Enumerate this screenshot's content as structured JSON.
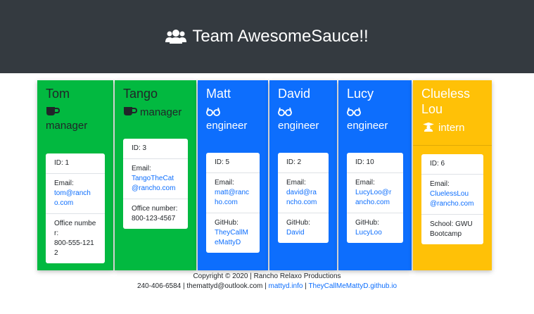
{
  "header": {
    "title": "Team AwesomeSauce!!",
    "icon": "users-icon"
  },
  "colors": {
    "manager": "#02b940",
    "engineer": "#0d6efd",
    "intern": "#ffc107",
    "hero": "#343a40"
  },
  "cards": [
    {
      "name": "Tom",
      "role": "manager",
      "role_icon": "coffee-icon",
      "id_text": "ID: 1",
      "contact_label": "Email:",
      "contact_value": "tom@rancho.com",
      "extra_label": "Office number:",
      "extra_value": "800-555-1212"
    },
    {
      "name": "Tango",
      "role": "manager",
      "role_icon": "coffee-icon",
      "id_text": "ID: 3",
      "contact_label": "Email:",
      "contact_value": "TangoTheCat@rancho.com",
      "extra_label": "Office number:",
      "extra_value": "800-123-4567"
    },
    {
      "name": "Matt",
      "role": "engineer",
      "role_icon": "glasses-icon",
      "id_text": "ID: 5",
      "contact_label": "Email:",
      "contact_value": "matt@rancho.com",
      "extra_label": "GitHub:",
      "extra_value": "TheyCallMeMattyD"
    },
    {
      "name": "David",
      "role": "engineer",
      "role_icon": "glasses-icon",
      "id_text": "ID: 2",
      "contact_label": "Email:",
      "contact_value": "david@rancho.com",
      "extra_label": "GitHub:",
      "extra_value": "David"
    },
    {
      "name": "Lucy",
      "role": "engineer",
      "role_icon": "glasses-icon",
      "id_text": "ID: 10",
      "contact_label": "Email:",
      "contact_value": "LucyLoo@rancho.com",
      "extra_label": "GitHub:",
      "extra_value": "LucyLoo"
    },
    {
      "name": "Clueless Lou",
      "role": "intern",
      "role_icon": "graduate-icon",
      "id_text": "ID: 6",
      "contact_label": "Email:",
      "contact_value": "CluelessLou@rancho.com",
      "extra_label": "School:",
      "extra_value": "GWU Bootcamp"
    }
  ],
  "footer": {
    "copyright": "Copyright © 2020 | Rancho Relaxo Productions",
    "contact": "240-406-6584 | themattyd@outlook.com |",
    "link1": "mattyd.info",
    "sep": "|",
    "link2": "TheyCallMeMattyD.github.io"
  }
}
